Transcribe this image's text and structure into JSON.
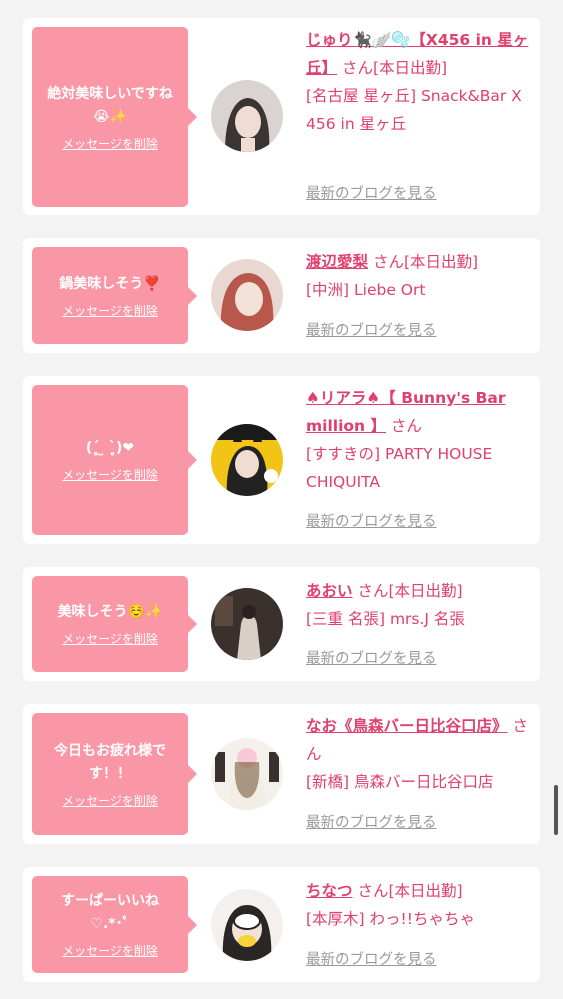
{
  "ui": {
    "delete_label": "メッセージを削除",
    "blog_label": "最新のブログを見る",
    "san": "さん"
  },
  "entries": [
    {
      "message": "絶対美味しいですね😭✨",
      "name": "じゅり🐈‍⬛🪽🫧【X456 in 星ヶ丘】",
      "status": "[本日出勤]",
      "shop": "[名古屋 星ヶ丘] Snack&Bar X 456 in 星ヶ丘"
    },
    {
      "message": "鍋美味しそう❣️",
      "name": "渡辺愛梨",
      "status": "[本日出勤]",
      "shop": "[中洲] Liebe Ort"
    },
    {
      "message": "(ˊ̥̥̥̥ ̫ ˋ̥̥̥̥)❤︎",
      "name": "♠リアラ♠【 Bunny's Bar million 】",
      "status": "",
      "shop": "[すすきの] PARTY HOUSE CHIQUITA"
    },
    {
      "message": "美味しそう☺️✨",
      "name": "あおい",
      "status": "[本日出勤]",
      "shop": "[三重 名張] mrs.J 名張"
    },
    {
      "message": "今日もお疲れ様です！！",
      "name": "なお《鳥森バー日比谷口店》",
      "status": "",
      "shop": "[新橋] 鳥森バー日比谷口店"
    },
    {
      "message": "すーぱーいいね ♡.*･ﾟ",
      "name": "ちなつ",
      "status": "[本日出勤]",
      "shop": "[本厚木] わっ!!ちゃちゃ"
    }
  ]
}
